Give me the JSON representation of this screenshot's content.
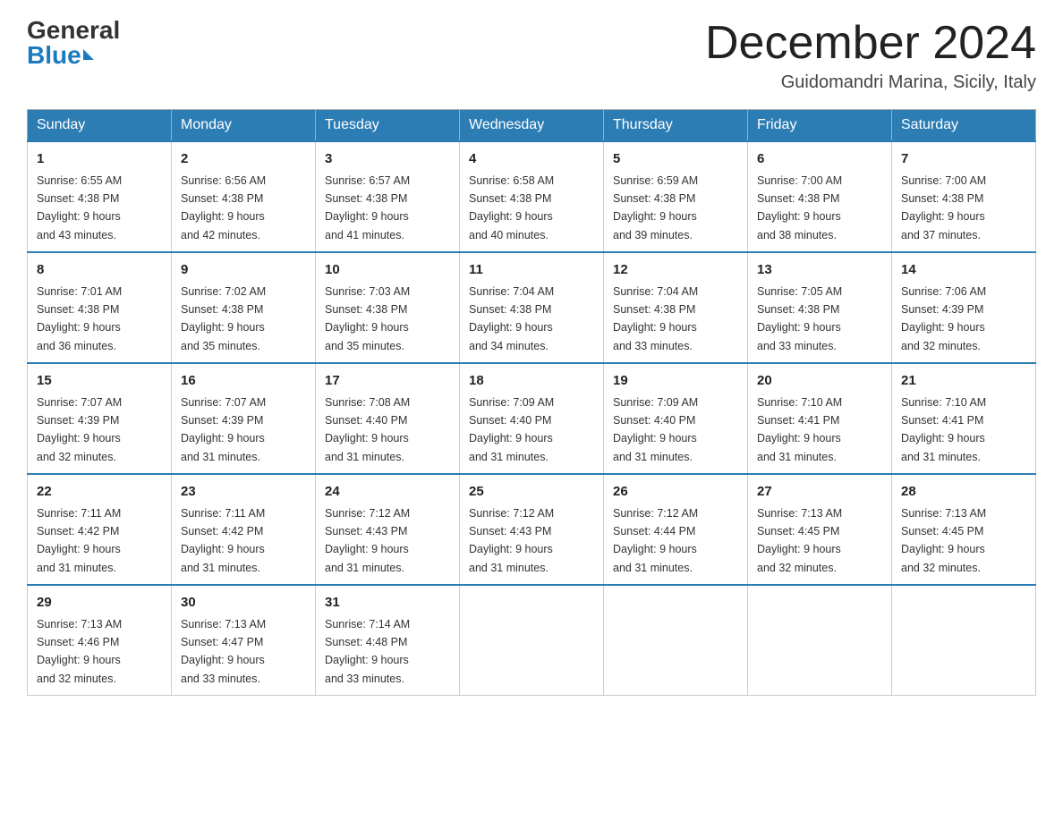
{
  "header": {
    "logo_general": "General",
    "logo_blue": "Blue",
    "month_title": "December 2024",
    "location": "Guidomandri Marina, Sicily, Italy"
  },
  "days_of_week": [
    "Sunday",
    "Monday",
    "Tuesday",
    "Wednesday",
    "Thursday",
    "Friday",
    "Saturday"
  ],
  "weeks": [
    [
      {
        "day": "1",
        "sunrise": "6:55 AM",
        "sunset": "4:38 PM",
        "daylight": "9 hours and 43 minutes."
      },
      {
        "day": "2",
        "sunrise": "6:56 AM",
        "sunset": "4:38 PM",
        "daylight": "9 hours and 42 minutes."
      },
      {
        "day": "3",
        "sunrise": "6:57 AM",
        "sunset": "4:38 PM",
        "daylight": "9 hours and 41 minutes."
      },
      {
        "day": "4",
        "sunrise": "6:58 AM",
        "sunset": "4:38 PM",
        "daylight": "9 hours and 40 minutes."
      },
      {
        "day": "5",
        "sunrise": "6:59 AM",
        "sunset": "4:38 PM",
        "daylight": "9 hours and 39 minutes."
      },
      {
        "day": "6",
        "sunrise": "7:00 AM",
        "sunset": "4:38 PM",
        "daylight": "9 hours and 38 minutes."
      },
      {
        "day": "7",
        "sunrise": "7:00 AM",
        "sunset": "4:38 PM",
        "daylight": "9 hours and 37 minutes."
      }
    ],
    [
      {
        "day": "8",
        "sunrise": "7:01 AM",
        "sunset": "4:38 PM",
        "daylight": "9 hours and 36 minutes."
      },
      {
        "day": "9",
        "sunrise": "7:02 AM",
        "sunset": "4:38 PM",
        "daylight": "9 hours and 35 minutes."
      },
      {
        "day": "10",
        "sunrise": "7:03 AM",
        "sunset": "4:38 PM",
        "daylight": "9 hours and 35 minutes."
      },
      {
        "day": "11",
        "sunrise": "7:04 AM",
        "sunset": "4:38 PM",
        "daylight": "9 hours and 34 minutes."
      },
      {
        "day": "12",
        "sunrise": "7:04 AM",
        "sunset": "4:38 PM",
        "daylight": "9 hours and 33 minutes."
      },
      {
        "day": "13",
        "sunrise": "7:05 AM",
        "sunset": "4:38 PM",
        "daylight": "9 hours and 33 minutes."
      },
      {
        "day": "14",
        "sunrise": "7:06 AM",
        "sunset": "4:39 PM",
        "daylight": "9 hours and 32 minutes."
      }
    ],
    [
      {
        "day": "15",
        "sunrise": "7:07 AM",
        "sunset": "4:39 PM",
        "daylight": "9 hours and 32 minutes."
      },
      {
        "day": "16",
        "sunrise": "7:07 AM",
        "sunset": "4:39 PM",
        "daylight": "9 hours and 31 minutes."
      },
      {
        "day": "17",
        "sunrise": "7:08 AM",
        "sunset": "4:40 PM",
        "daylight": "9 hours and 31 minutes."
      },
      {
        "day": "18",
        "sunrise": "7:09 AM",
        "sunset": "4:40 PM",
        "daylight": "9 hours and 31 minutes."
      },
      {
        "day": "19",
        "sunrise": "7:09 AM",
        "sunset": "4:40 PM",
        "daylight": "9 hours and 31 minutes."
      },
      {
        "day": "20",
        "sunrise": "7:10 AM",
        "sunset": "4:41 PM",
        "daylight": "9 hours and 31 minutes."
      },
      {
        "day": "21",
        "sunrise": "7:10 AM",
        "sunset": "4:41 PM",
        "daylight": "9 hours and 31 minutes."
      }
    ],
    [
      {
        "day": "22",
        "sunrise": "7:11 AM",
        "sunset": "4:42 PM",
        "daylight": "9 hours and 31 minutes."
      },
      {
        "day": "23",
        "sunrise": "7:11 AM",
        "sunset": "4:42 PM",
        "daylight": "9 hours and 31 minutes."
      },
      {
        "day": "24",
        "sunrise": "7:12 AM",
        "sunset": "4:43 PM",
        "daylight": "9 hours and 31 minutes."
      },
      {
        "day": "25",
        "sunrise": "7:12 AM",
        "sunset": "4:43 PM",
        "daylight": "9 hours and 31 minutes."
      },
      {
        "day": "26",
        "sunrise": "7:12 AM",
        "sunset": "4:44 PM",
        "daylight": "9 hours and 31 minutes."
      },
      {
        "day": "27",
        "sunrise": "7:13 AM",
        "sunset": "4:45 PM",
        "daylight": "9 hours and 32 minutes."
      },
      {
        "day": "28",
        "sunrise": "7:13 AM",
        "sunset": "4:45 PM",
        "daylight": "9 hours and 32 minutes."
      }
    ],
    [
      {
        "day": "29",
        "sunrise": "7:13 AM",
        "sunset": "4:46 PM",
        "daylight": "9 hours and 32 minutes."
      },
      {
        "day": "30",
        "sunrise": "7:13 AM",
        "sunset": "4:47 PM",
        "daylight": "9 hours and 33 minutes."
      },
      {
        "day": "31",
        "sunrise": "7:14 AM",
        "sunset": "4:48 PM",
        "daylight": "9 hours and 33 minutes."
      },
      null,
      null,
      null,
      null
    ]
  ],
  "labels": {
    "sunrise": "Sunrise:",
    "sunset": "Sunset:",
    "daylight": "Daylight:"
  }
}
